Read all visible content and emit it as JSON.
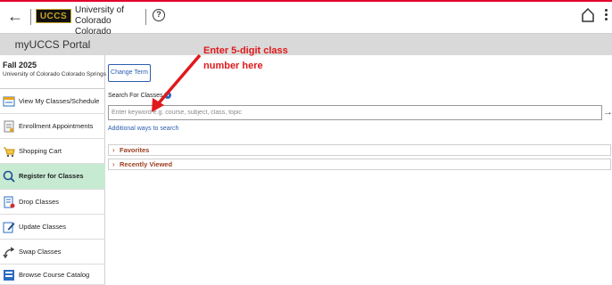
{
  "header": {
    "back_icon": "arrow-left-icon",
    "logo_mark": "UCCS",
    "logo_text": "University of Colorado Colorado Springs",
    "help_icon": "help-circle-icon",
    "home_icon": "home-icon",
    "menu_icon": "vertical-dots-icon",
    "accent_color": "#e4002b"
  },
  "portal": {
    "title": "myUCCS Portal"
  },
  "term": {
    "name": "Fall 2025",
    "school": "University of Colorado Colorado Springs",
    "change_label": "Change Term"
  },
  "sidebar": {
    "items": [
      {
        "label": "View My Classes/Schedule",
        "icon": "calendar-icon",
        "active": false
      },
      {
        "label": "Enrollment Appointments",
        "icon": "document-icon",
        "active": false
      },
      {
        "label": "Shopping Cart",
        "icon": "cart-icon",
        "active": false
      },
      {
        "label": "Register for Classes",
        "icon": "search-icon",
        "active": true
      },
      {
        "label": "Drop Classes",
        "icon": "drop-list-icon",
        "active": false
      },
      {
        "label": "Update Classes",
        "icon": "edit-icon",
        "active": false
      },
      {
        "label": "Swap Classes",
        "icon": "swap-icon",
        "active": false
      },
      {
        "label": "Browse Course Catalog",
        "icon": "catalog-icon",
        "active": false
      }
    ],
    "active_color": "#c7ead2"
  },
  "search": {
    "label": "Search For Classes",
    "placeholder": "Enter keyword e.g. course, subject, class, topic",
    "value": "",
    "go_icon": "arrow-right-icon",
    "additional_link": "Additional ways to search"
  },
  "accordions": [
    {
      "label": "Favorites"
    },
    {
      "label": "Recently Viewed"
    }
  ],
  "annotation": {
    "line1": "Enter 5-digit class",
    "line2": "number here",
    "color": "#e0191c"
  }
}
